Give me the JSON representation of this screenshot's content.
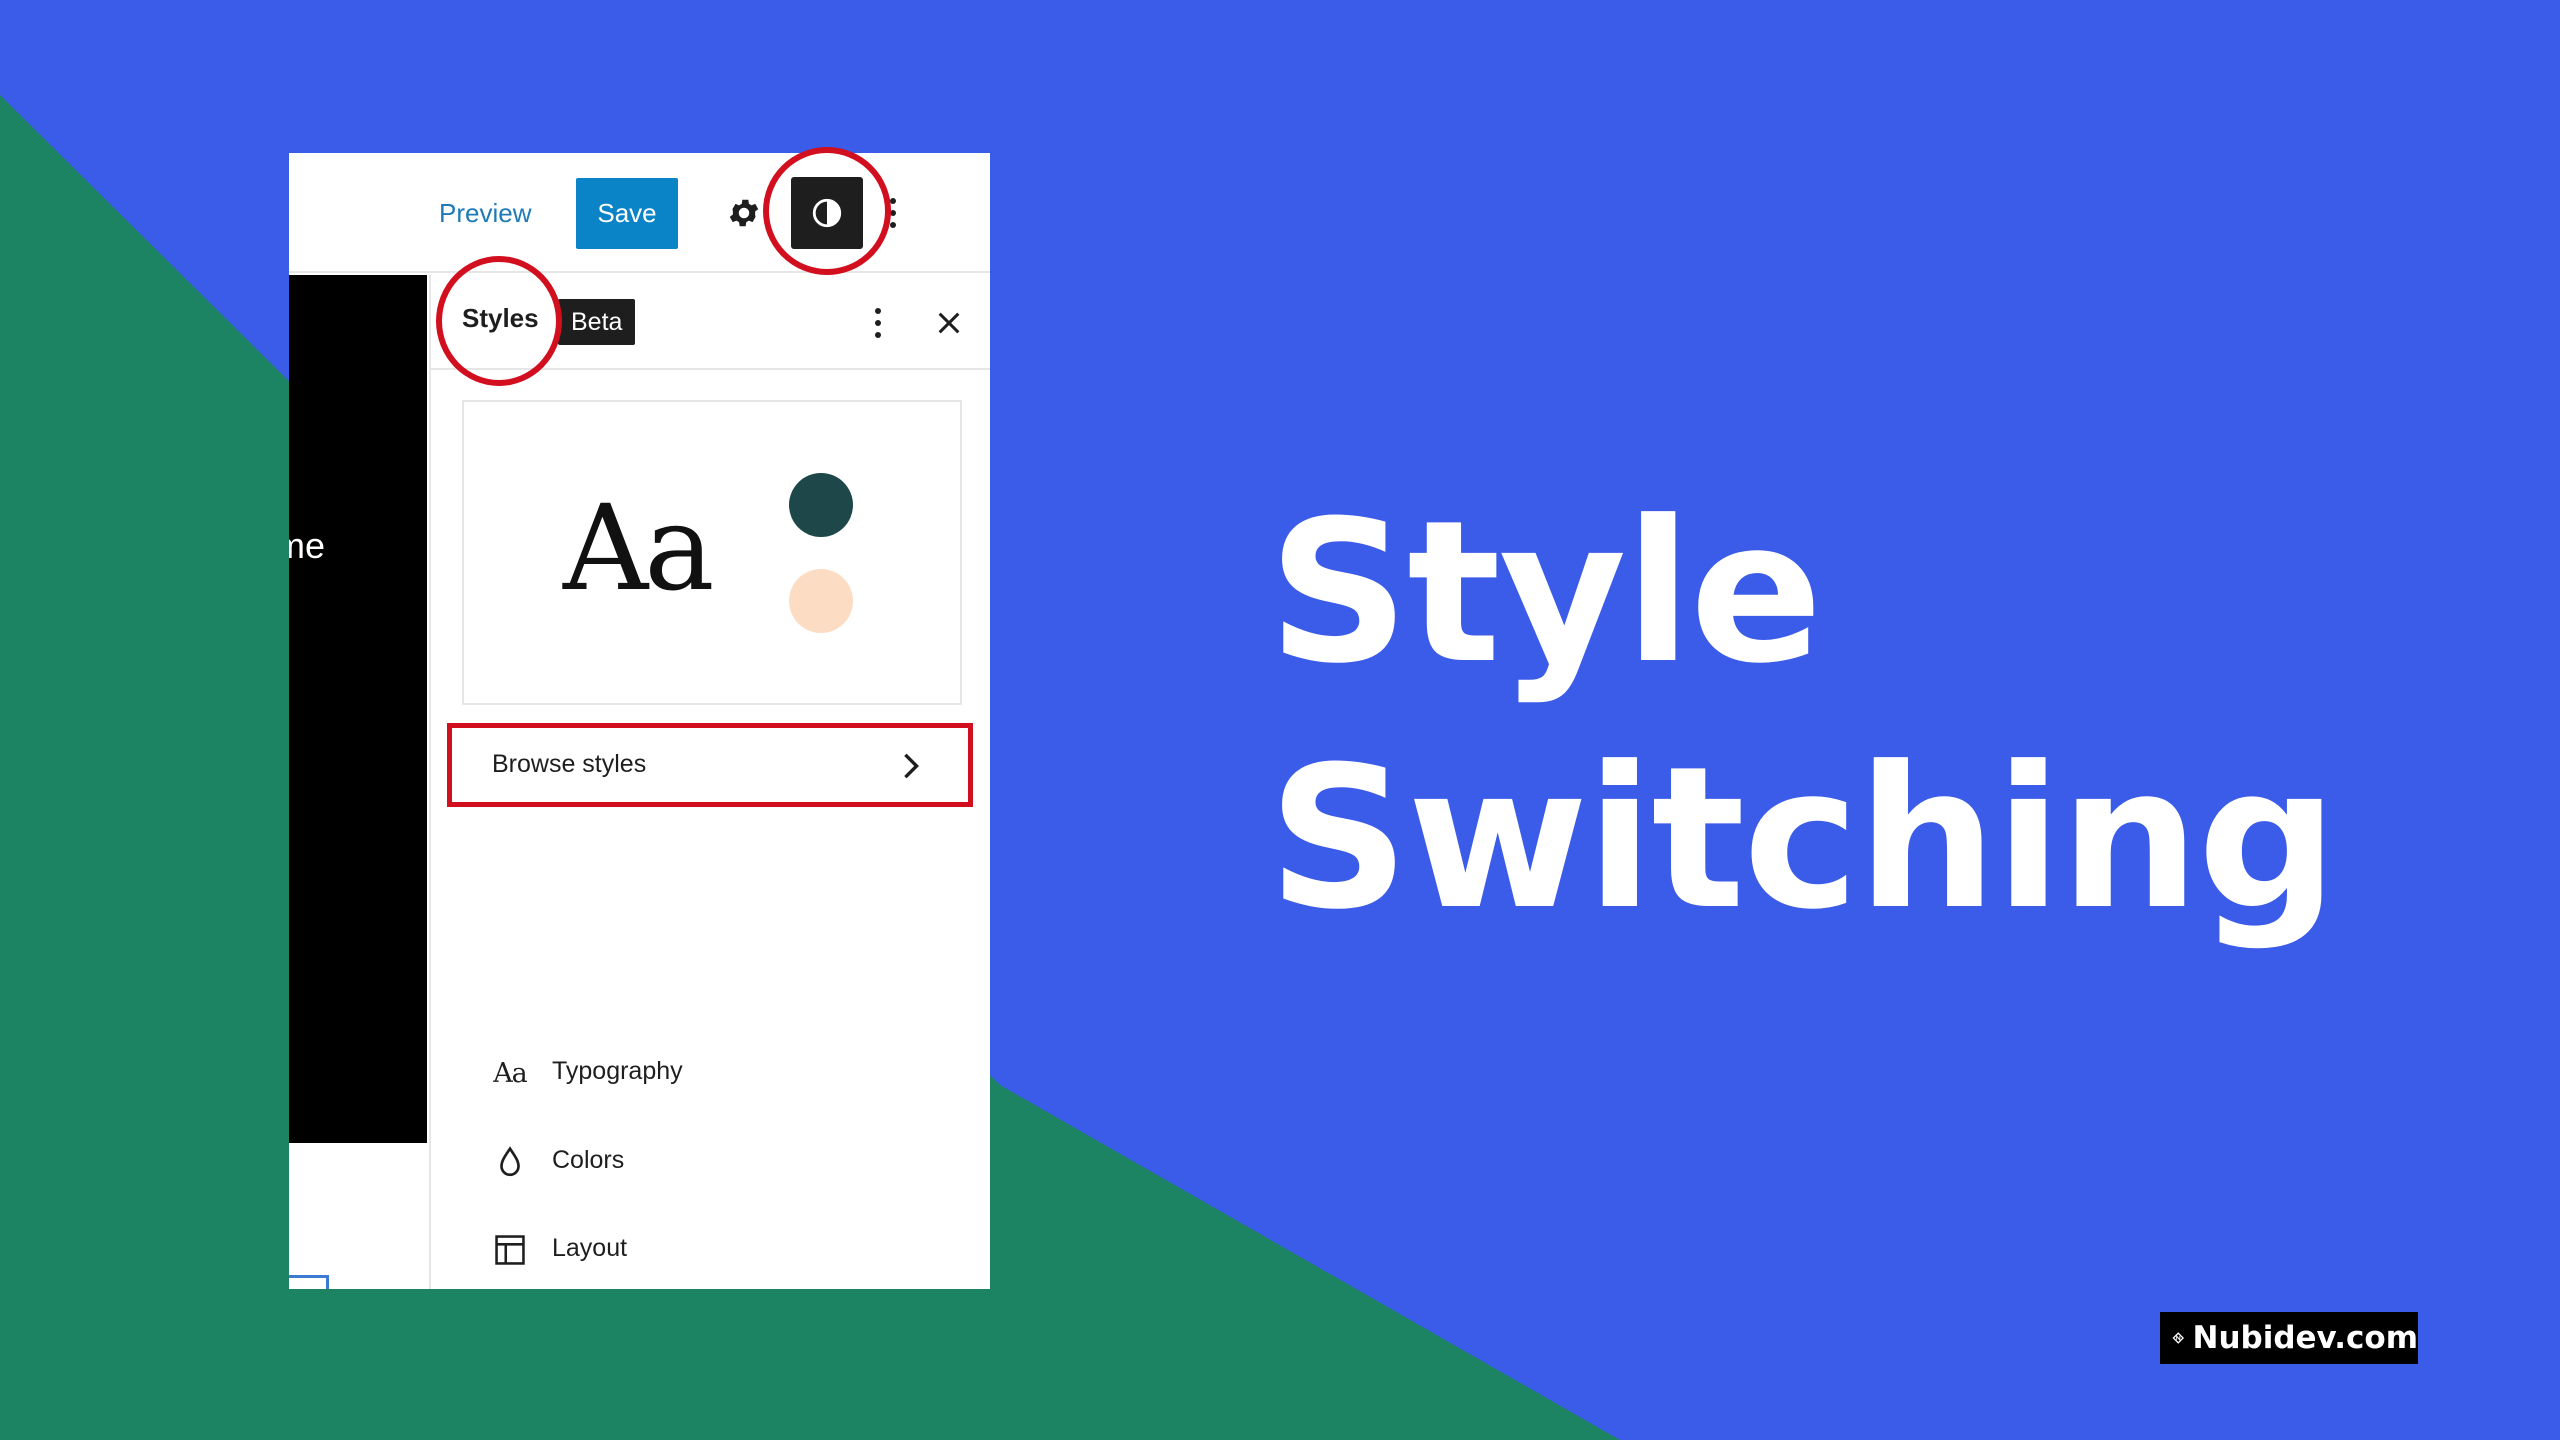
{
  "headline": {
    "line1": "Style",
    "line2": "Switching"
  },
  "brand": {
    "text": "Nubidev.com",
    "logo_icon": "nubidev-diamond-logo"
  },
  "colors": {
    "background_blue": "#3b5be9",
    "background_green": "#1c8462",
    "annotation_red": "#d20f1f",
    "save_button": "#0a84c7",
    "palette_dark": "#1e4749",
    "palette_light": "#fddcc4"
  },
  "toolbar": {
    "preview_label": "Preview",
    "save_label": "Save",
    "settings_icon": "gear-icon",
    "styles_toggle_icon": "half-circle-contrast-icon",
    "options_icon": "vertical-ellipsis-icon"
  },
  "canvas": {
    "partial_text": "me"
  },
  "sidebar": {
    "title": "Styles",
    "badge": "Beta",
    "options_icon": "vertical-ellipsis-icon",
    "close_icon": "close-icon",
    "preview_card": {
      "sample_text": "Aa"
    },
    "browse_label": "Browse styles",
    "browse_icon": "chevron-right-icon",
    "items": [
      {
        "icon": "typography-icon",
        "icon_text": "Aa",
        "label": "Typography"
      },
      {
        "icon": "droplet-icon",
        "label": "Colors"
      },
      {
        "icon": "layout-icon",
        "label": "Layout"
      }
    ]
  }
}
